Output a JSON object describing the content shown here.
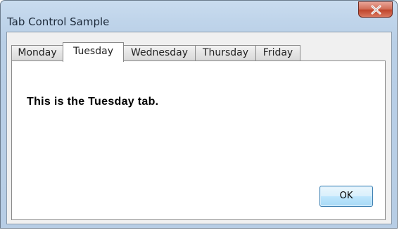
{
  "window": {
    "title": "Tab Control Sample",
    "close_glyph": "x"
  },
  "tabs": [
    {
      "label": "Monday",
      "active": false
    },
    {
      "label": "Tuesday",
      "active": true
    },
    {
      "label": "Wednesday",
      "active": false
    },
    {
      "label": "Thursday",
      "active": false
    },
    {
      "label": "Friday",
      "active": false
    }
  ],
  "panel": {
    "text": "This is the Tuesday tab."
  },
  "buttons": {
    "ok_label": "OK"
  },
  "colors": {
    "title_bar": "#bfd4ea",
    "close_button": "#c0472d",
    "dialog_background": "#f0f0f0",
    "ok_button_border": "#3c7fb1"
  },
  "icons": {
    "close": "close-icon"
  }
}
